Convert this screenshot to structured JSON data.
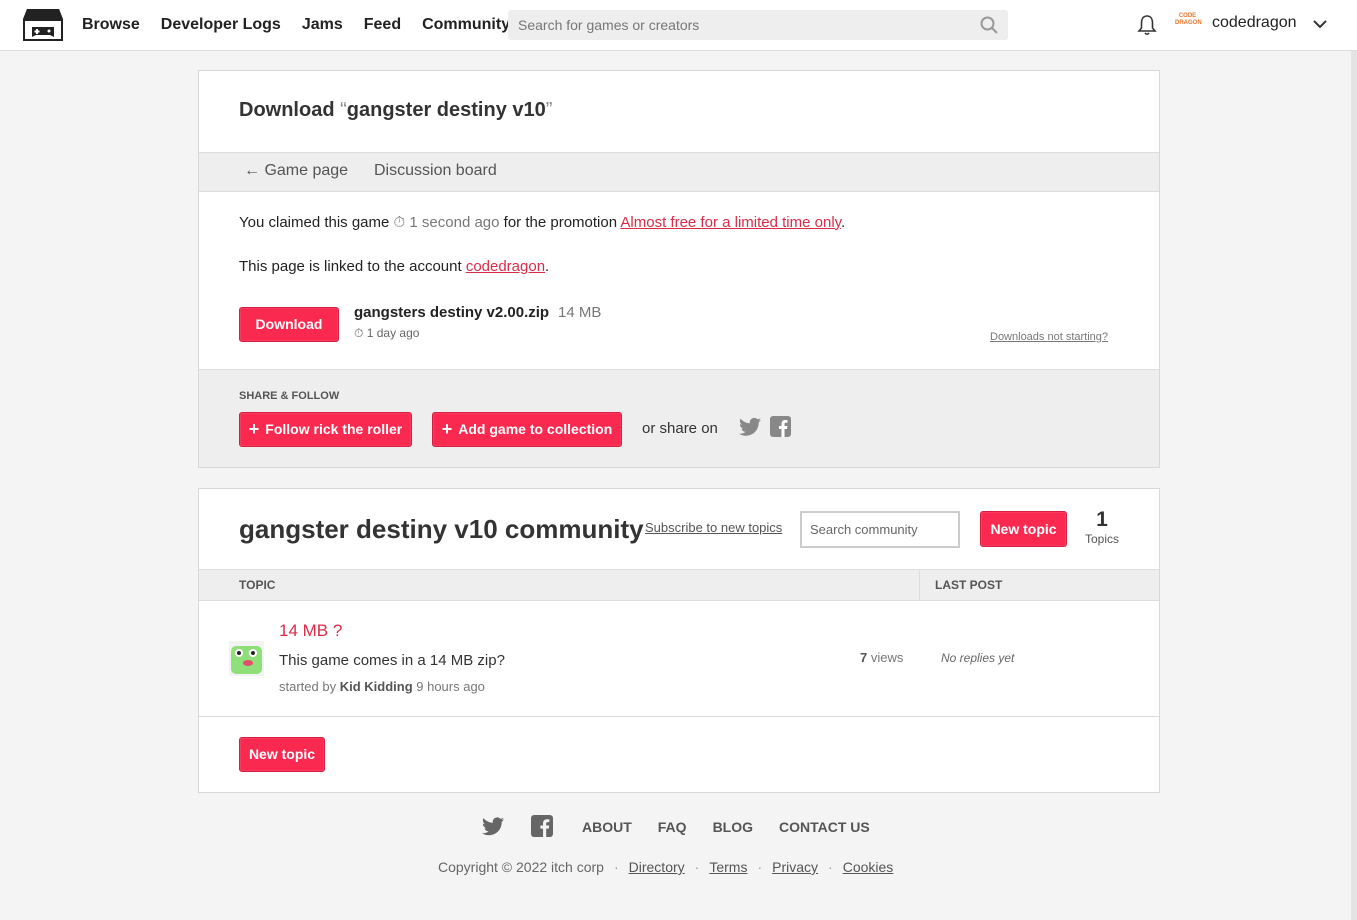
{
  "header": {
    "nav": [
      "Browse",
      "Developer Logs",
      "Jams",
      "Feed",
      "Community"
    ],
    "search_placeholder": "Search for games or creators",
    "avatar_text": "CODE DRAGON",
    "username": "codedragon"
  },
  "download": {
    "title_prefix": "Download ",
    "open_quote": "“",
    "game_name": "gangster destiny v10",
    "close_quote": "”",
    "subnav_back": "← Game page",
    "subnav_discussion": "Discussion board",
    "claim_prefix": "You claimed this game ",
    "claim_time": "1 second ago",
    "claim_mid": " for the promotion ",
    "promotion": "Almost free for a limited time only",
    "claim_end": ".",
    "linked_prefix": "This page is linked to the account ",
    "linked_account": "codedragon",
    "linked_end": ".",
    "download_button": "Download",
    "file_name": "gangsters destiny v2.00.zip",
    "file_size": "14 MB",
    "file_date": "1 day ago",
    "help_link": "Downloads not starting?"
  },
  "share": {
    "heading": "SHARE & FOLLOW",
    "follow_button": "Follow rick the roller",
    "collection_button": "Add game to collection",
    "share_on": "or share on"
  },
  "community": {
    "title": "gangster destiny v10 community",
    "subscribe": "Subscribe to new topics",
    "search_placeholder": "Search community",
    "new_topic": "New topic",
    "topic_count": "1",
    "topic_count_label": "Topics",
    "col_topic": "TOPIC",
    "col_last_post": "LAST POST",
    "topics": [
      {
        "title": "14 MB ?",
        "body": "This game comes in a 14 MB zip?",
        "started_by_label": "started by ",
        "author": "Kid Kidding",
        "time": " 9 hours ago",
        "views_count": "7",
        "views_label": " views",
        "last_post": "No replies yet"
      }
    ],
    "new_topic_bottom": "New topic"
  },
  "footer": {
    "links": [
      "ABOUT",
      "FAQ",
      "BLOG",
      "CONTACT US"
    ],
    "copyright": "Copyright © 2022 itch corp",
    "bottom_links": [
      "Directory",
      "Terms",
      "Privacy",
      "Cookies"
    ]
  },
  "colors": {
    "accent": "#fa2950",
    "link_red": "#da2c49",
    "background": "#f4f4f4"
  },
  "icons": [
    "itch-logo-icon",
    "search-icon",
    "bell-icon",
    "chevron-down-icon",
    "stopwatch-icon",
    "twitter-icon",
    "facebook-icon",
    "plus-icon",
    "frog-avatar-icon"
  ]
}
